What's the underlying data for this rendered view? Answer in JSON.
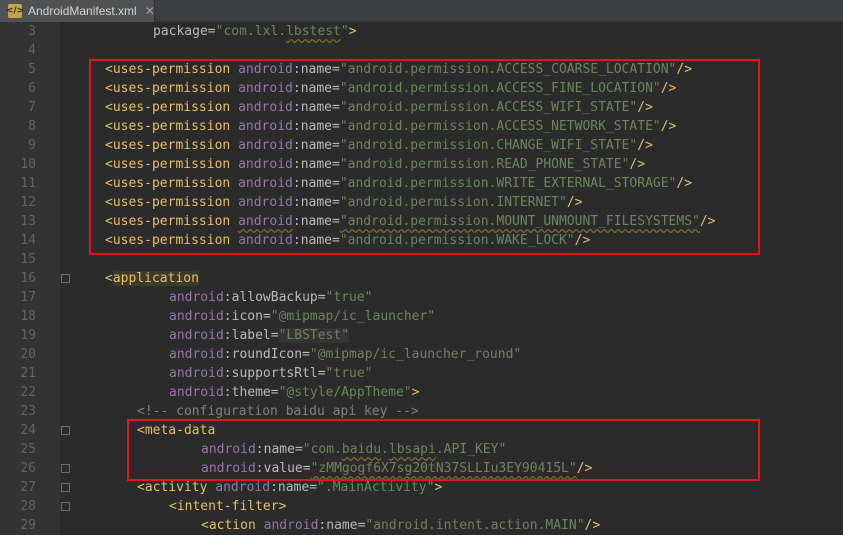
{
  "tab": {
    "title": "AndroidManifest.xml",
    "icon": "xml-file-icon",
    "close": "✕"
  },
  "colors": {
    "tag": "#e8bf6a",
    "attr": "#bababa",
    "ns": "#9876aa",
    "value": "#6a8759",
    "comment": "#808080",
    "highlight_box": "#e3141a"
  },
  "lines": {
    "l3": {
      "num": "3",
      "attr": "package",
      "eq": "=",
      "value_pre": "\"com.lxl.",
      "value_sq": "lbstest",
      "value_post": "\"",
      "end": ">"
    },
    "l4": {
      "num": "4"
    },
    "l5": {
      "num": "5",
      "open": "<",
      "tag": "uses-permission",
      "ns": "android",
      "colon": ":",
      "attr": "name",
      "eq": "=",
      "value": "\"android.permission.ACCESS_COARSE_LOCATION\"",
      "end": "/>"
    },
    "l6": {
      "num": "6",
      "open": "<",
      "tag": "uses-permission",
      "ns": "android",
      "colon": ":",
      "attr": "name",
      "eq": "=",
      "value": "\"android.permission.ACCESS_FINE_LOCATION\"",
      "end": "/>"
    },
    "l7": {
      "num": "7",
      "open": "<",
      "tag": "uses-permission",
      "ns": "android",
      "colon": ":",
      "attr": "name",
      "eq": "=",
      "value": "\"android.permission.ACCESS_WIFI_STATE\"",
      "end": "/>"
    },
    "l8": {
      "num": "8",
      "open": "<",
      "tag": "uses-permission",
      "ns": "android",
      "colon": ":",
      "attr": "name",
      "eq": "=",
      "value": "\"android.permission.ACCESS_NETWORK_STATE\"",
      "end": "/>"
    },
    "l9": {
      "num": "9",
      "open": "<",
      "tag": "uses-permission",
      "ns": "android",
      "colon": ":",
      "attr": "name",
      "eq": "=",
      "value": "\"android.permission.CHANGE_WIFI_STATE\"",
      "end": "/>"
    },
    "l10": {
      "num": "10",
      "open": "<",
      "tag": "uses-permission",
      "ns": "android",
      "colon": ":",
      "attr": "name",
      "eq": "=",
      "value": "\"android.permission.READ_PHONE_STATE\"",
      "end": "/>"
    },
    "l11": {
      "num": "11",
      "open": "<",
      "tag": "uses-permission",
      "ns": "android",
      "colon": ":",
      "attr": "name",
      "eq": "=",
      "value": "\"android.permission.WRITE_EXTERNAL_STORAGE\"",
      "end": "/>"
    },
    "l12": {
      "num": "12",
      "open": "<",
      "tag": "uses-permission",
      "ns": "android",
      "colon": ":",
      "attr": "name",
      "eq": "=",
      "value": "\"android.permission.INTERNET\"",
      "end": "/>"
    },
    "l13": {
      "num": "13",
      "open": "<",
      "tag": "uses-permission",
      "ns": "android",
      "colon": ":",
      "attr": "name",
      "eq": "=",
      "value": "\"android.permission.MOUNT_UNMOUNT_FILESYSTEMS\"",
      "end": "/>"
    },
    "l14": {
      "num": "14",
      "open": "<",
      "tag": "uses-permission",
      "ns": "android",
      "colon": ":",
      "attr": "name",
      "eq": "=",
      "value": "\"android.permission.WAKE_LOCK\"",
      "end": "/>"
    },
    "l15": {
      "num": "15"
    },
    "l16": {
      "num": "16",
      "open": "<",
      "tag": "application"
    },
    "l17": {
      "num": "17",
      "ns": "android",
      "colon": ":",
      "attr": "allowBackup",
      "eq": "=",
      "value": "\"true\""
    },
    "l18": {
      "num": "18",
      "ns": "android",
      "colon": ":",
      "attr": "icon",
      "eq": "=",
      "value": "\"@mipmap/ic_launcher\""
    },
    "l19": {
      "num": "19",
      "ns": "android",
      "colon": ":",
      "attr": "label",
      "eq": "=",
      "value": "\"LBSTest\""
    },
    "l20": {
      "num": "20",
      "ns": "android",
      "colon": ":",
      "attr": "roundIcon",
      "eq": "=",
      "value": "\"@mipmap/ic_launcher_round\""
    },
    "l21": {
      "num": "21",
      "ns": "android",
      "colon": ":",
      "attr": "supportsRtl",
      "eq": "=",
      "value": "\"true\""
    },
    "l22": {
      "num": "22",
      "ns": "android",
      "colon": ":",
      "attr": "theme",
      "eq": "=",
      "value": "\"@style/AppTheme\"",
      "end": ">"
    },
    "l23": {
      "num": "23",
      "comment": "<!-- configuration baidu api key -->"
    },
    "l24": {
      "num": "24",
      "open": "<",
      "tag": "meta-data"
    },
    "l25": {
      "num": "25",
      "ns": "android",
      "colon": ":",
      "attr": "name",
      "eq": "=",
      "value_pre": "\"com.",
      "value_sq": "baidu",
      "value_mid": ".",
      "value_sq2": "lbsapi",
      "value_post": ".API_KEY\""
    },
    "l26": {
      "num": "26",
      "ns": "android",
      "colon": ":",
      "attr": "value",
      "eq": "=",
      "value": "\"zMMgogf6X7sg20tN37SLLIu3EY90415L\"",
      "end": "/>"
    },
    "l27": {
      "num": "27",
      "open": "<",
      "tag": "activity",
      "ns": "android",
      "colon": ":",
      "attr": "name",
      "eq": "=",
      "value": "\".MainActivity\"",
      "end": ">"
    },
    "l28": {
      "num": "28",
      "open": "<",
      "tag": "intent-filter",
      "end": ">"
    },
    "l29": {
      "num": "29",
      "open": "<",
      "tag": "action",
      "ns": "android",
      "colon": ":",
      "attr": "name",
      "eq": "=",
      "value": "\"android.intent.action.MAIN\"",
      "end": "/>"
    }
  }
}
